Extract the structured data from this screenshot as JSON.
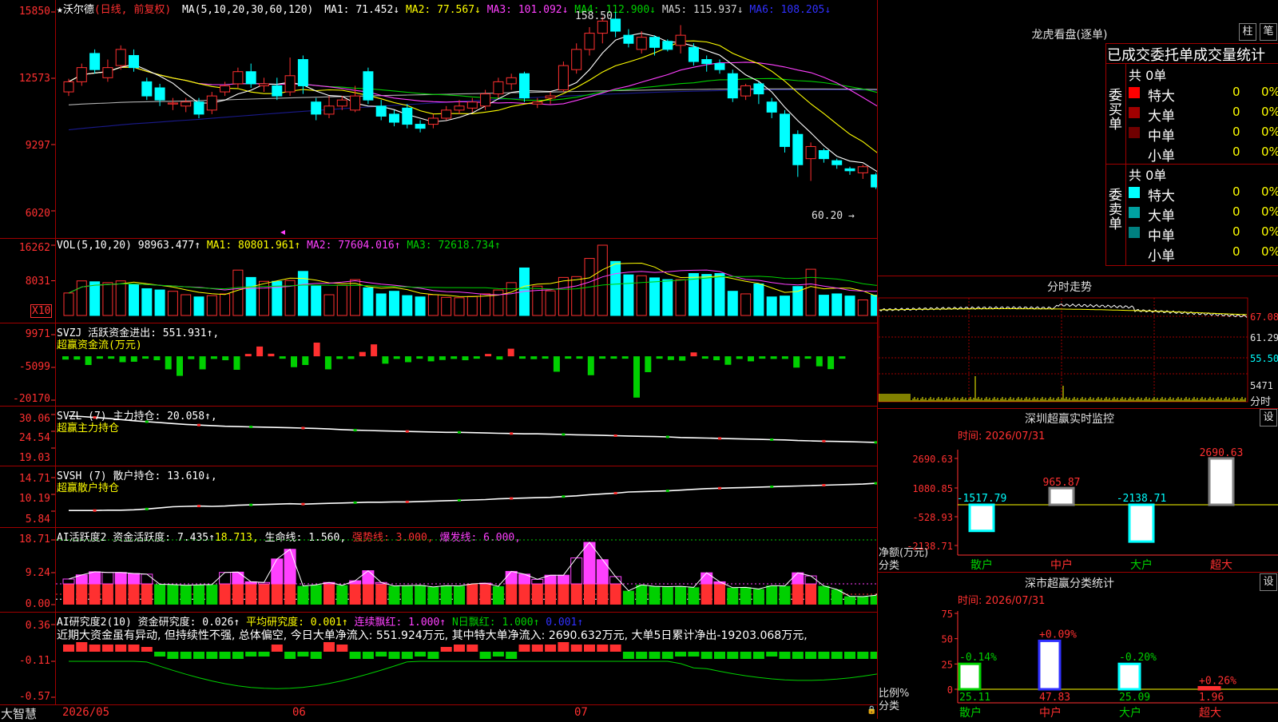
{
  "app": {
    "brand": "大智慧"
  },
  "colors": {
    "up": "#ff3030",
    "down": "#00ffff",
    "green": "#00d000",
    "yellow": "#ffff00",
    "magenta": "#ff40ff",
    "white": "#ffffff",
    "blue": "#3030ff",
    "grid": "#a00000"
  },
  "main": {
    "star": "★",
    "stock": "沃尔德",
    "period": "(日线, 前复权)",
    "ma_label": "MA(5,10,20,30,60,120)",
    "ma1": "MA1: 71.452↓",
    "ma2": "MA2: 77.567↓",
    "ma3": "MA3: 101.092↓",
    "ma4": "MA4: 112.900↓",
    "ma5": "MA5: 115.937↓",
    "ma6": "MA6: 108.205↓",
    "high_mark": "158.50",
    "low_mark": "60.20",
    "yaxis": [
      "15850",
      "12573",
      "9297",
      "6020"
    ]
  },
  "vol": {
    "label": "VOL(5,10,20)",
    "value": "98963.477↑",
    "ma1": "MA1: 80801.961↑",
    "ma2": "MA2: 77604.016↑",
    "ma3": "MA3: 72618.734↑",
    "yaxis": [
      "16262",
      "8031"
    ],
    "unit": "X10"
  },
  "svzj": {
    "label": "SVZJ  活跃资金进出: 551.931↑,",
    "sub": "超赢资金流(万元)",
    "yaxis": [
      "9971",
      "-5099",
      "-20170"
    ]
  },
  "svzl": {
    "label": "SVZL (7) 主力持仓: 20.058↑,",
    "sub": "超赢主力持仓",
    "yaxis": [
      "30.06",
      "24.54",
      "19.03"
    ]
  },
  "svsh": {
    "label": "SVSH (7) 散户持仓: 13.610↓,",
    "sub": "超赢散户持仓",
    "yaxis": [
      "14.71",
      "10.19",
      "5.84"
    ]
  },
  "ai_act": {
    "label": "AI活跃度2 资金活跃度: 7.435↑",
    "v2": "18.713,",
    "v3": "生命线: 1.560,",
    "v4": "强势线: 3.000,",
    "v5": "爆发线: 6.000,",
    "yaxis": [
      "18.71",
      "9.24",
      "0.00"
    ]
  },
  "ai_res": {
    "label": "AI研究度2(10) 资金研究度: 0.026↑",
    "v2": "平均研究度: 0.001↑",
    "v3": "连续飘红: 1.000↑",
    "v4": "N日飘红: 1.000↑",
    "v5": "0.001↑",
    "comment": "近期大资金虽有异动, 但持续性不强, 总体偏空, 今日大单净流入: 551.924万元, 其中特大单净流入: 2690.632万元, 大单5日累计净出-19203.068万元,",
    "yaxis": [
      "0.36",
      "-0.11",
      "-0.57"
    ]
  },
  "xaxis": [
    "2026/05",
    "06",
    "07"
  ],
  "right": {
    "title": "龙虎看盘(逐单)",
    "btn_bar": "柱",
    "btn_pen": "笔",
    "stat_title": "已成交委托单成交量统计",
    "buy": {
      "side": "委买单",
      "total": "共 0单",
      "rows": [
        {
          "name": "特大",
          "count": "0",
          "pct": "0%",
          "color": "#ff0000"
        },
        {
          "name": "大单",
          "count": "0",
          "pct": "0%",
          "color": "#a00000"
        },
        {
          "name": "中单",
          "count": "0",
          "pct": "0%",
          "color": "#700000"
        },
        {
          "name": "小单",
          "count": "0",
          "pct": "0%",
          "color": ""
        }
      ]
    },
    "sell": {
      "side": "委卖单",
      "total": "共 0单",
      "rows": [
        {
          "name": "特大",
          "count": "0",
          "pct": "0%",
          "color": "#00ffff"
        },
        {
          "name": "大单",
          "count": "0",
          "pct": "0%",
          "color": "#00a0a0"
        },
        {
          "name": "中单",
          "count": "0",
          "pct": "0%",
          "color": "#008080"
        },
        {
          "name": "小单",
          "count": "0",
          "pct": "0%",
          "color": ""
        }
      ]
    },
    "intraday_title": "分时走势",
    "intraday_axis": [
      "67.08",
      "61.29",
      "55.50",
      "5471"
    ],
    "intraday_unit": "分时",
    "monitor_title": "深圳超赢实时监控",
    "monitor_btn": "设",
    "monitor_time": "时间: 2026/07/31",
    "monitor_axis": [
      "2690.63",
      "1080.85",
      "-528.93",
      "-2138.71"
    ],
    "monitor_ylabel": "净额(万元)",
    "monitor_xlabel": "分类",
    "monitor_vals": [
      "-1517.79",
      "965.87",
      "-2138.71",
      "2690.63"
    ],
    "categories": [
      "散户",
      "中户",
      "大户",
      "超大"
    ],
    "class_title": "深市超赢分类统计",
    "class_btn": "设",
    "class_time": "时间: 2026/07/31",
    "class_axis": [
      "75",
      "50",
      "25",
      "0"
    ],
    "class_ylabel": "比例%",
    "class_xlabel": "分类",
    "class_top": [
      "-0.14%",
      "+0.09%",
      "-0.20%",
      "+0.26%"
    ],
    "class_vals": [
      "25.11",
      "47.83",
      "25.09",
      "1.96"
    ]
  },
  "chart_data": [
    {
      "type": "candlestick",
      "title": "沃尔德 (日线, 前复权)",
      "ylim": [
        6020,
        15850
      ],
      "candles": [
        [
          11900,
          12400,
          12550,
          11700,
          1
        ],
        [
          12400,
          13100,
          13300,
          12200,
          1
        ],
        [
          13800,
          13000,
          14000,
          12800,
          0
        ],
        [
          12600,
          13100,
          13500,
          12400,
          1
        ],
        [
          13200,
          14000,
          14200,
          13000,
          1
        ],
        [
          13700,
          13100,
          14000,
          12900,
          0
        ],
        [
          12400,
          11700,
          12600,
          11500,
          0
        ],
        [
          12100,
          11500,
          12300,
          11200,
          0
        ],
        [
          11300,
          11350,
          11600,
          11000,
          1
        ],
        [
          11200,
          11400,
          11600,
          10900,
          1
        ],
        [
          11400,
          10800,
          11600,
          10600,
          0
        ],
        [
          11000,
          11700,
          11900,
          10800,
          1
        ],
        [
          11900,
          12200,
          12400,
          11700,
          1
        ],
        [
          12300,
          12900,
          13100,
          12100,
          1
        ],
        [
          12900,
          12300,
          13300,
          12100,
          0
        ],
        [
          12200,
          12300,
          12600,
          11900,
          1
        ],
        [
          12200,
          11700,
          12600,
          11500,
          0
        ],
        [
          11900,
          12700,
          13600,
          11700,
          1
        ],
        [
          13500,
          12200,
          13700,
          11800,
          0
        ],
        [
          11400,
          10800,
          11600,
          10500,
          0
        ],
        [
          10800,
          11200,
          11700,
          10600,
          1
        ],
        [
          11200,
          11500,
          11700,
          11000,
          1
        ],
        [
          11700,
          11000,
          12200,
          10900,
          1
        ],
        [
          12900,
          11500,
          13100,
          11300,
          0
        ],
        [
          11200,
          10700,
          11500,
          10500,
          0
        ],
        [
          10800,
          10400,
          11000,
          10200,
          0
        ],
        [
          11100,
          10300,
          11300,
          10100,
          0
        ],
        [
          10300,
          10100,
          10500,
          9900,
          0
        ],
        [
          10300,
          10600,
          10800,
          10100,
          1
        ],
        [
          10600,
          11000,
          11200,
          10500,
          1
        ],
        [
          11000,
          11200,
          11500,
          10800,
          1
        ],
        [
          11100,
          11400,
          11600,
          10900,
          1
        ],
        [
          11200,
          11800,
          12000,
          11000,
          1
        ],
        [
          11800,
          12400,
          12600,
          11600,
          1
        ],
        [
          12300,
          12600,
          12800,
          12000,
          1
        ],
        [
          12800,
          11600,
          12900,
          11400,
          0
        ],
        [
          11400,
          11300,
          11600,
          11100,
          1
        ],
        [
          11600,
          11700,
          11900,
          11300,
          1
        ],
        [
          12000,
          13200,
          13400,
          11900,
          1
        ],
        [
          13000,
          14000,
          14300,
          12800,
          1
        ],
        [
          14000,
          14800,
          15100,
          13700,
          1
        ],
        [
          14800,
          15400,
          15600,
          14300,
          1
        ],
        [
          15500,
          14900,
          15850,
          14600,
          0
        ],
        [
          14700,
          14300,
          15000,
          14100,
          0
        ],
        [
          14000,
          14600,
          14900,
          13800,
          1
        ],
        [
          14600,
          14100,
          14700,
          13700,
          0
        ],
        [
          14400,
          14000,
          14500,
          13900,
          0
        ],
        [
          14200,
          14700,
          15200,
          13800,
          1
        ],
        [
          14100,
          13400,
          14300,
          13200,
          0
        ],
        [
          13300,
          13500,
          13700,
          12900,
          0
        ],
        [
          13300,
          13000,
          13500,
          12800,
          0
        ],
        [
          12800,
          11600,
          13000,
          11400,
          0
        ],
        [
          11700,
          12200,
          12300,
          11500,
          1
        ],
        [
          12300,
          11800,
          12400,
          11300,
          0
        ],
        [
          11400,
          10900,
          11600,
          10600,
          0
        ],
        [
          10800,
          9200,
          11000,
          8900,
          0
        ],
        [
          9800,
          8300,
          10000,
          7700,
          0
        ],
        [
          8600,
          9200,
          9400,
          7500,
          1
        ],
        [
          9000,
          8600,
          9100,
          8400,
          0
        ],
        [
          8500,
          8300,
          8600,
          8100,
          0
        ],
        [
          8100,
          8000,
          8200,
          7800,
          0
        ],
        [
          8200,
          7900,
          8300,
          7600,
          1
        ],
        [
          7800,
          7200,
          7900,
          7100,
          0
        ],
        [
          7400,
          6800,
          7500,
          6600,
          0
        ],
        [
          6900,
          6020,
          7100,
          6020,
          0
        ],
        [
          6300,
          6450,
          6800,
          6020,
          0
        ]
      ]
    },
    {
      "type": "bar",
      "title": "VOL(5,10,20)",
      "ylim": [
        0,
        16262
      ],
      "values": [
        5200,
        8000,
        7800,
        7600,
        8000,
        7200,
        6200,
        5900,
        5600,
        4800,
        4300,
        4600,
        5000,
        10500,
        8800,
        7900,
        7900,
        8100,
        10200,
        6800,
        4800,
        7000,
        8300,
        6400,
        5000,
        5600,
        4600,
        4300,
        4800,
        4200,
        4100,
        4400,
        5000,
        5900,
        7600,
        11000,
        6800,
        5700,
        8800,
        9000,
        13200,
        16262,
        12500,
        9400,
        9200,
        8700,
        8300,
        8300,
        9700,
        9500,
        9700,
        5600,
        5000,
        7300,
        4300,
        4500,
        6700,
        10700,
        4700,
        5000,
        4500,
        3600,
        4700,
        11200,
        9600,
        9300
      ]
    },
    {
      "type": "bar",
      "title": "SVZJ 超赢资金流(万元)",
      "ylim": [
        -20170,
        9971
      ],
      "values": [
        -1500,
        -1500,
        -4000,
        -700,
        -500,
        -2700,
        -2500,
        -700,
        -1800,
        -6000,
        -9000,
        -1300,
        -6000,
        -1200,
        -1800,
        -6200,
        0,
        4500,
        1200,
        -800,
        -5000,
        -4000,
        6300,
        -6000,
        -1200,
        -1200,
        2000,
        5500,
        -3400,
        -1200,
        -2700,
        -1000,
        -2300,
        -1700,
        -1200,
        -1800,
        -1000,
        0,
        -1500,
        3500,
        -300,
        -1300,
        -1000,
        -7100,
        -1000,
        -1000,
        -8700,
        -1000,
        -1000,
        -1000,
        -19000,
        -7300,
        -1000,
        -1700,
        -2000,
        1800,
        -1000,
        -1800,
        -3900,
        -1200,
        -2300,
        -600,
        -1200,
        -1200,
        -5200,
        -1000,
        -4600,
        -5900,
        -200
      ]
    },
    {
      "type": "line",
      "title": "SVZL 超赢主力持仓",
      "ylim": [
        19.03,
        30.06
      ],
      "values": [
        29.6,
        29.4,
        29.1,
        28.8,
        28.4,
        28.0,
        27.7,
        27.4,
        27.1,
        26.8,
        26.6,
        26.4,
        26.2,
        26.1,
        26.0,
        25.9,
        25.8,
        25.7,
        25.6,
        25.5,
        25.3,
        25.1,
        24.9,
        24.8,
        24.7,
        24.6,
        24.5,
        24.4,
        24.3,
        24.2,
        24.2,
        24.1,
        24.0,
        23.9,
        23.8,
        23.7,
        23.7,
        23.6,
        23.5,
        23.4,
        23.3,
        23.2,
        23.1,
        23.0,
        22.9,
        22.8,
        22.7,
        22.5,
        22.4,
        22.3,
        22.2,
        22.1,
        22.0,
        21.9,
        21.8,
        21.7,
        21.5,
        21.4,
        21.3,
        21.2,
        21.1,
        21.0,
        20.9,
        20.5,
        20.0,
        20.06
      ]
    },
    {
      "type": "line",
      "title": "SVSH 超赢散户持仓",
      "ylim": [
        5.84,
        14.71
      ],
      "values": [
        6.0,
        6.0,
        6.0,
        6.1,
        6.1,
        6.2,
        6.4,
        6.7,
        7.0,
        7.1,
        7.2,
        7.1,
        7.2,
        7.4,
        7.5,
        7.6,
        7.7,
        7.8,
        7.7,
        7.8,
        7.9,
        8.0,
        8.1,
        8.2,
        8.2,
        8.3,
        8.3,
        8.4,
        8.5,
        8.6,
        8.7,
        8.8,
        8.9,
        9.1,
        9.2,
        9.3,
        9.4,
        9.5,
        9.7,
        9.9,
        10.2,
        10.4,
        10.6,
        10.9,
        11.0,
        11.1,
        11.2,
        11.4,
        11.6,
        11.8,
        11.9,
        12.0,
        12.1,
        12.2,
        12.3,
        12.4,
        12.5,
        12.6,
        12.7,
        12.8,
        12.9,
        13.0,
        13.2,
        13.5,
        14.0,
        13.61
      ]
    },
    {
      "type": "bar",
      "title": "AI活跃度2 资金活跃度",
      "ylim": [
        0,
        18.71
      ],
      "values": [
        7.4,
        8.6,
        9.5,
        9.3,
        9.3,
        9.0,
        8.8,
        5.9,
        5.8,
        5.6,
        5.7,
        5.8,
        9.3,
        9.4,
        6.6,
        6.4,
        13.2,
        16.0,
        5.4,
        5.7,
        6.4,
        5.6,
        6.9,
        9.8,
        6.4,
        5.4,
        5.5,
        5.6,
        5.1,
        5.5,
        5.4,
        6.0,
        6.2,
        5.3,
        9.6,
        8.8,
        7.3,
        8.5,
        8.5,
        13.5,
        18.0,
        13.0,
        8.1,
        4.0,
        5.7,
        5.3,
        5.2,
        5.3,
        5.0,
        9.2,
        6.6,
        4.9,
        5.0,
        4.5,
        5.5,
        5.4,
        9.2,
        8.3,
        5.4,
        4.4,
        2.4,
        2.3,
        2.7,
        7.4,
        5.0,
        7.4
      ],
      "lines": {
        "life": 1.56,
        "strong": 3.0,
        "burst": 6.0
      }
    },
    {
      "type": "bar",
      "title": "AI研究度2(10) 资金研究度",
      "ylim": [
        -0.57,
        0.36
      ],
      "values": [
        0.03,
        0.04,
        0.03,
        0.03,
        0.03,
        0.03,
        0.02,
        -0.02,
        -0.03,
        -0.03,
        -0.03,
        -0.03,
        -0.03,
        -0.03,
        -0.02,
        -0.02,
        0.03,
        -0.03,
        -0.02,
        -0.03,
        0.04,
        0.03,
        -0.03,
        -0.03,
        -0.02,
        -0.03,
        -0.03,
        -0.02,
        -0.03,
        0.02,
        0.03,
        0.03,
        -0.03,
        -0.02,
        -0.03,
        0.03,
        0.03,
        0.03,
        0.04,
        0.03,
        0.03,
        0.03,
        0.03,
        -0.03,
        -0.03,
        -0.03,
        -0.03,
        -0.02,
        -0.02,
        -0.03,
        -0.03,
        -0.03,
        -0.03,
        -0.03,
        -0.02,
        -0.03,
        -0.03,
        -0.03,
        -0.03,
        -0.03,
        -0.03,
        -0.03,
        -0.03,
        -0.03,
        -0.03,
        0.026
      ]
    }
  ]
}
